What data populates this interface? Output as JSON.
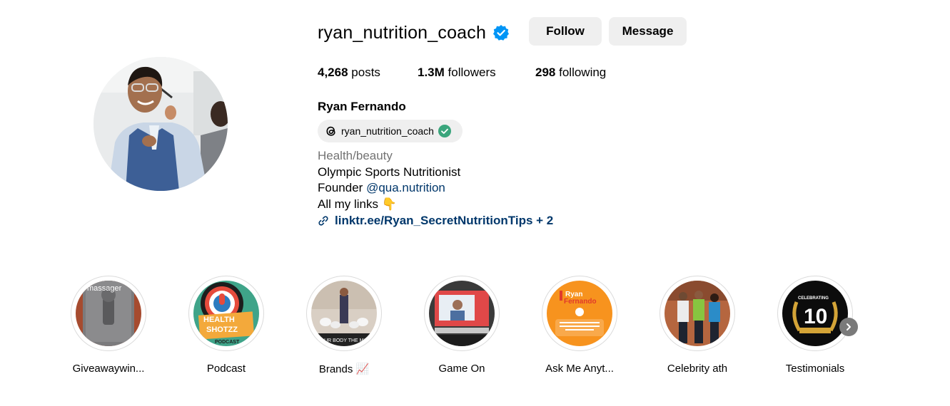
{
  "profile": {
    "username": "ryan_nutrition_coach",
    "follow_label": "Follow",
    "message_label": "Message",
    "stats": {
      "posts_count": "4,268",
      "posts_label": "posts",
      "followers_count": "1.3M",
      "followers_label": "followers",
      "following_count": "298",
      "following_label": "following"
    },
    "full_name": "Ryan Fernando",
    "threads_handle": "ryan_nutrition_coach",
    "category": "Health/beauty",
    "bio_line1": "Olympic Sports Nutritionist",
    "bio_line2_prefix": "Founder",
    "bio_mention": "@qua.nutrition",
    "bio_line3": "All my links 👇",
    "link": "linktr.ee/Ryan_SecretNutritionTips + 2"
  },
  "highlights": [
    {
      "label": "Giveawaywin...",
      "thumb_text": "massager"
    },
    {
      "label": "Podcast",
      "thumb_text_1": "HEALTH",
      "thumb_text_2": "SHOTZZ",
      "thumb_text_3": "PODCAST"
    },
    {
      "label": "Brands 📈",
      "thumb_text": "YOUR BODY THE MO"
    },
    {
      "label": "Game On"
    },
    {
      "label": "Ask Me Anyt...",
      "thumb_text_1": "Ryan",
      "thumb_text_2": "Fernando"
    },
    {
      "label": "Celebrity ath"
    },
    {
      "label": "Testimonials",
      "thumb_text_1": "CELEBRATING",
      "thumb_text_2": "10"
    }
  ],
  "colors": {
    "verified_blue": "#0095f6",
    "link_blue": "#00376b",
    "button_gray": "#efefef",
    "threads_check_green": "#3aa57c"
  },
  "icons": [
    "verified-badge-icon",
    "threads-icon",
    "check-circle-icon",
    "link-icon",
    "chevron-right-icon"
  ]
}
